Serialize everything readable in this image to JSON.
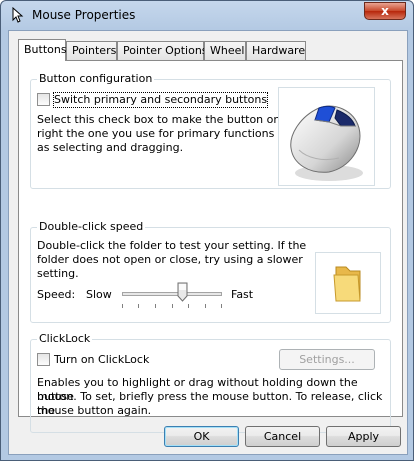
{
  "window": {
    "title": "Mouse Properties",
    "close_glyph": "x"
  },
  "tabs": [
    {
      "label": "Buttons",
      "active": true
    },
    {
      "label": "Pointers",
      "active": false
    },
    {
      "label": "Pointer Options",
      "active": false
    },
    {
      "label": "Wheel",
      "active": false
    },
    {
      "label": "Hardware",
      "active": false
    }
  ],
  "button_config": {
    "title": "Button configuration",
    "checkbox_label": "Switch primary and secondary buttons",
    "checked": false,
    "description_lines": [
      "Select this check box to make the button on the",
      "right the one you use for primary functions such",
      "as selecting and dragging."
    ]
  },
  "double_click": {
    "title": "Double-click speed",
    "description_lines": [
      "Double-click the folder to test your setting. If the",
      "folder does not open or close, try using a slower",
      "setting."
    ],
    "speed_label": "Speed:",
    "slow_label": "Slow",
    "fast_label": "Fast",
    "speed_fraction": 0.6
  },
  "clicklock": {
    "title": "ClickLock",
    "checkbox_label": "Turn on ClickLock",
    "checked": false,
    "settings_button": "Settings...",
    "description_lines": [
      "Enables you to highlight or drag without holding down the mouse",
      "button. To set, briefly press the mouse button. To release, click the",
      "mouse button again."
    ]
  },
  "buttons": {
    "ok": "OK",
    "cancel": "Cancel",
    "apply": "Apply"
  },
  "icons": {
    "title": "mouse-pointer-icon",
    "mouse_preview": "mouse-illustration",
    "folder": "folder-icon"
  },
  "colors": {
    "accent_blue": "#1f4fd6",
    "folder": "#f4d46c"
  }
}
